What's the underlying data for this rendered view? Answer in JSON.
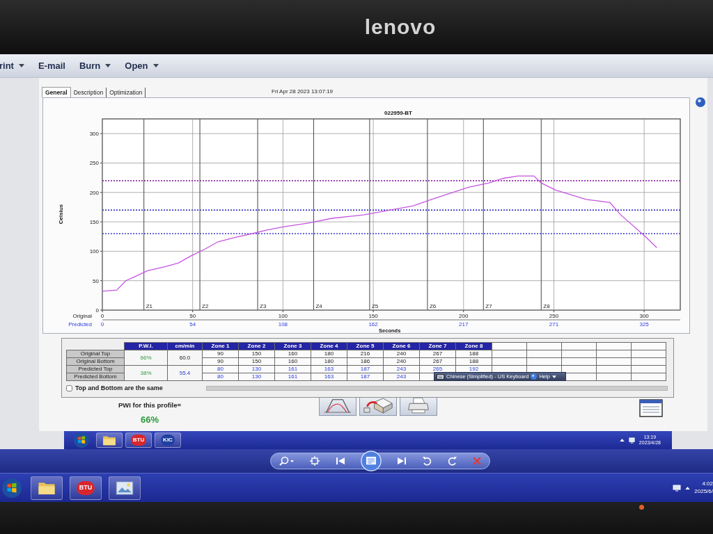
{
  "monitor": {
    "logo": "lenovo"
  },
  "menu": [
    {
      "label": "rint",
      "dropdown": true
    },
    {
      "label": "E-mail",
      "dropdown": false
    },
    {
      "label": "Burn",
      "dropdown": true
    },
    {
      "label": "Open",
      "dropdown": true
    }
  ],
  "tabs": [
    {
      "label": "General",
      "selected": true
    },
    {
      "label": "Description",
      "selected": false
    },
    {
      "label": "Optimization",
      "selected": false
    }
  ],
  "timestamp": "Fri Apr 28 2023 13:07:19",
  "profile_chart": {
    "chart_data": {
      "type": "line",
      "title": "022959-BT",
      "xlabel": "Seconds",
      "ylabel": "Celsius",
      "xlim": [
        0,
        320
      ],
      "ylim": [
        0,
        325
      ],
      "xticks": [
        0,
        50,
        100,
        150,
        200,
        250,
        300
      ],
      "yticks": [
        0,
        50,
        100,
        150,
        200,
        250,
        300
      ],
      "grid": true,
      "x": [
        0,
        8,
        13,
        18,
        25,
        35,
        42,
        49,
        57,
        64,
        74,
        83,
        91,
        101,
        114,
        127,
        145,
        172,
        183,
        203,
        214,
        222,
        230,
        239,
        243,
        251,
        268,
        281,
        287,
        301,
        307
      ],
      "series": [
        {
          "color": "#c455e0",
          "values": [
            32,
            34,
            50,
            57,
            67,
            74,
            80,
            92,
            104,
            116,
            124,
            130,
            136,
            142,
            148,
            156,
            162,
            177,
            189,
            209,
            216,
            224,
            228,
            228,
            216,
            204,
            188,
            183,
            162,
            124,
            106
          ]
        }
      ],
      "ref_lines": [
        {
          "axis": "y",
          "value": 220,
          "color": "#8e2aa8"
        },
        {
          "axis": "y",
          "value": 170,
          "color": "#3a3ac8"
        },
        {
          "axis": "y",
          "value": 130,
          "color": "#3a3ac8"
        },
        {
          "axis": "x",
          "value": 23,
          "label": "Z1",
          "color": "#555555"
        },
        {
          "axis": "x",
          "value": 54,
          "label": "Z2",
          "color": "#555555"
        },
        {
          "axis": "x",
          "value": 86,
          "label": "Z3",
          "color": "#555555"
        },
        {
          "axis": "x",
          "value": 117,
          "label": "Z4",
          "color": "#555555"
        },
        {
          "axis": "x",
          "value": 148,
          "label": "Z5",
          "color": "#555555"
        },
        {
          "axis": "x",
          "value": 180,
          "label": "Z6",
          "color": "#555555"
        },
        {
          "axis": "x",
          "value": 211,
          "label": "Z7",
          "color": "#555555"
        },
        {
          "axis": "x",
          "value": 243,
          "label": "Z8",
          "color": "#555555"
        }
      ]
    },
    "original_label": "Original",
    "predicted_axis": {
      "label": "Predicted",
      "ticks": [
        "0",
        "54",
        "108",
        "162",
        "217",
        "271",
        "325"
      ]
    }
  },
  "zone_table": {
    "columns": [
      "P.W.I.",
      "cm/min",
      "Zone 1",
      "Zone 2",
      "Zone 3",
      "Zone 4",
      "Zone 5",
      "Zone 6",
      "Zone 7",
      "Zone 8"
    ],
    "groups": [
      {
        "kind": "original",
        "pwi": "66%",
        "speed": "60.0",
        "rows": [
          {
            "label": "Original Top",
            "zones": [
              "90",
              "150",
              "160",
              "180",
              "216",
              "240",
              "267",
              "188"
            ]
          },
          {
            "label": "Original Bottom",
            "zones": [
              "90",
              "150",
              "160",
              "180",
              "186",
              "240",
              "267",
              "188"
            ]
          }
        ]
      },
      {
        "kind": "predicted",
        "pwi": "38%",
        "speed": "55.4",
        "rows": [
          {
            "label": "Predicted Top",
            "zones": [
              "80",
              "130",
              "161",
              "163",
              "187",
              "243",
              "265",
              "192"
            ]
          },
          {
            "label": "Predicted Bottom",
            "zones": [
              "80",
              "130",
              "161",
              "163",
              "187",
              "243"
            ]
          }
        ]
      }
    ],
    "same_checkbox": {
      "label": "Top and Bottom are the same",
      "checked": false
    }
  },
  "language_bar": {
    "language": "Chinese (Simplified) - US Keyboard",
    "help": "Help"
  },
  "pwi_summary": {
    "label": "PWI for this profile=",
    "value": "66%"
  },
  "inner_taskbar": {
    "apps": [
      {
        "label": "BTU",
        "color": "#d8262c"
      },
      {
        "label": "KIC",
        "color": "#1f3f9f"
      }
    ],
    "time": "13:19",
    "date": "2023/4/28"
  },
  "outer_taskbar": {
    "apps": [
      {
        "label": "BTU",
        "color": "#d8262c"
      }
    ],
    "time": "4:02",
    "date": "2025/6/"
  }
}
